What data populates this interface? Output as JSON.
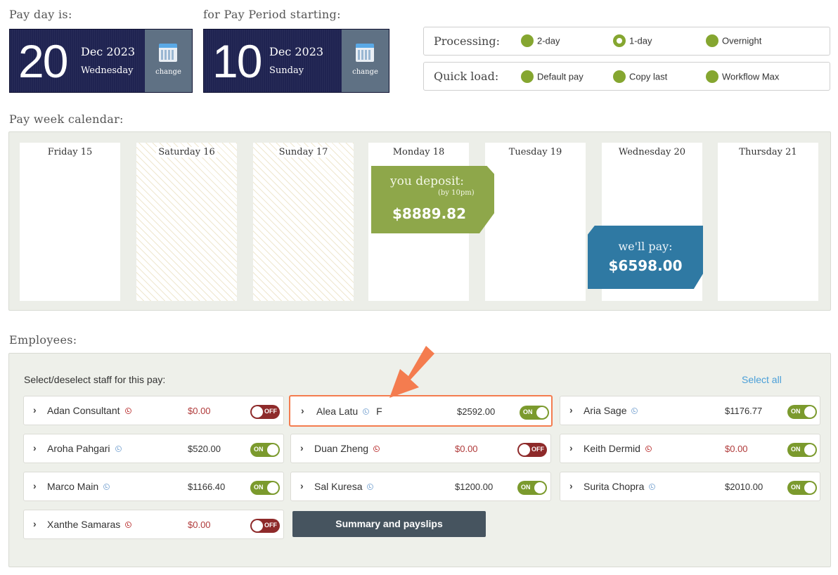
{
  "payday": {
    "label": "Pay day is:",
    "day": "20",
    "month_year": "Dec 2023",
    "weekday": "Wednesday",
    "change_label": "change"
  },
  "period": {
    "label": "for Pay Period starting:",
    "day": "10",
    "month_year": "Dec 2023",
    "weekday": "Sunday",
    "change_label": "change"
  },
  "processing": {
    "label": "Processing:",
    "options": [
      "2-day",
      "1-day",
      "Overnight"
    ],
    "selected": "1-day"
  },
  "quickload": {
    "label": "Quick load:",
    "options": [
      "Default pay",
      "Copy last",
      "Workflow Max"
    ]
  },
  "calendar": {
    "label": "Pay week calendar:",
    "days": [
      "Friday 15",
      "Saturday 16",
      "Sunday 17",
      "Monday 18",
      "Tuesday 19",
      "Wednesday 20",
      "Thursday 21"
    ],
    "deposit": {
      "title": "you deposit:",
      "note": "(by 10pm)",
      "amount": "$8889.82"
    },
    "pay": {
      "title": "we'll pay:",
      "amount": "$6598.00"
    }
  },
  "employees": {
    "label": "Employees:",
    "intro": "Select/deselect staff for this pay:",
    "select_all": "Select all",
    "summary_button": "Summary and payslips",
    "toggle_on": "ON",
    "toggle_off": "OFF",
    "list": [
      {
        "name": "Adan Consultant",
        "clock": "red",
        "code": "",
        "amount": "$0.00",
        "on": false
      },
      {
        "name": "Alea Latu",
        "clock": "blue",
        "code": "F",
        "amount": "$2592.00",
        "on": true
      },
      {
        "name": "Aria Sage",
        "clock": "blue",
        "code": "",
        "amount": "$1176.77",
        "on": true
      },
      {
        "name": "Aroha Pahgari",
        "clock": "blue",
        "code": "",
        "amount": "$520.00",
        "on": true
      },
      {
        "name": "Duan Zheng",
        "clock": "red",
        "code": "",
        "amount": "$0.00",
        "on": false
      },
      {
        "name": "Keith Dermid",
        "clock": "red",
        "code": "",
        "amount": "$0.00",
        "on": true
      },
      {
        "name": "Marco Main",
        "clock": "blue",
        "code": "",
        "amount": "$1166.40",
        "on": true
      },
      {
        "name": "Sal Kuresa",
        "clock": "blue",
        "code": "",
        "amount": "$1200.00",
        "on": true
      },
      {
        "name": "Surita Chopra",
        "clock": "blue",
        "code": "",
        "amount": "$2010.00",
        "on": true
      },
      {
        "name": "Xanthe Samaras",
        "clock": "red",
        "code": "",
        "amount": "$0.00",
        "on": false
      }
    ]
  },
  "colors": {
    "navy": "#1f2351",
    "green": "#85a630",
    "blue": "#2f79a3",
    "highlight": "#f47c4f",
    "off_red": "#8e2a2a"
  }
}
